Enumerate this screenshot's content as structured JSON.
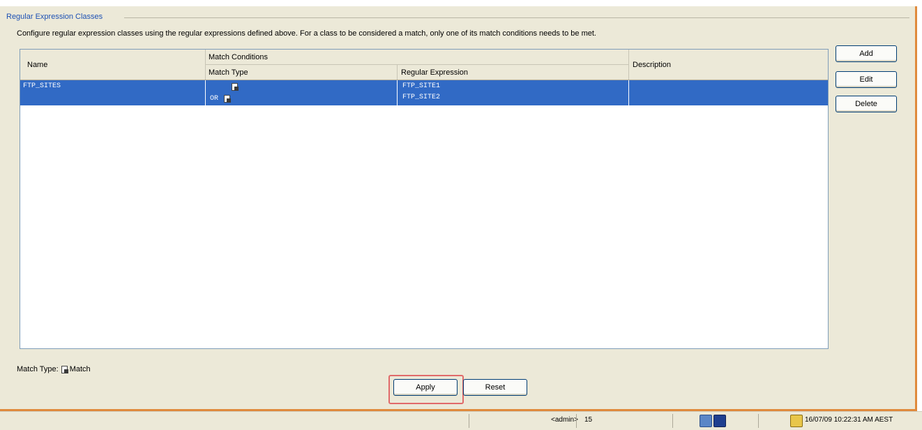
{
  "group": {
    "title": "Regular Expression Classes"
  },
  "description": "Configure regular expression classes using the regular expressions defined above. For a class to be considered a match, only one of its match conditions needs to be met.",
  "table": {
    "headers": {
      "name": "Name",
      "match_conditions": "Match Conditions",
      "match_type": "Match Type",
      "regular_expression": "Regular Expression",
      "description": "Description"
    },
    "rows": [
      {
        "name": "FTP_SITES",
        "or_label": "OR",
        "expressions": [
          "FTP_SITE1",
          "FTP_SITE2"
        ],
        "description": "",
        "match_icon": "match-icon"
      }
    ]
  },
  "side_buttons": {
    "add": "Add",
    "edit": "Edit",
    "delete": "Delete"
  },
  "legend": {
    "label": "Match Type:",
    "match_label": "Match",
    "icon": "match-icon"
  },
  "footer_buttons": {
    "apply": "Apply",
    "reset": "Reset"
  },
  "status_bar": {
    "user": "<admin>",
    "privilege": "15",
    "datetime": "16/07/09 10:22:31 AM AEST"
  },
  "colors": {
    "selection": "#316ac5",
    "group_title": "#1d51b4",
    "highlight_box": "#e06a6a",
    "panel_bg": "#ece9d8"
  }
}
